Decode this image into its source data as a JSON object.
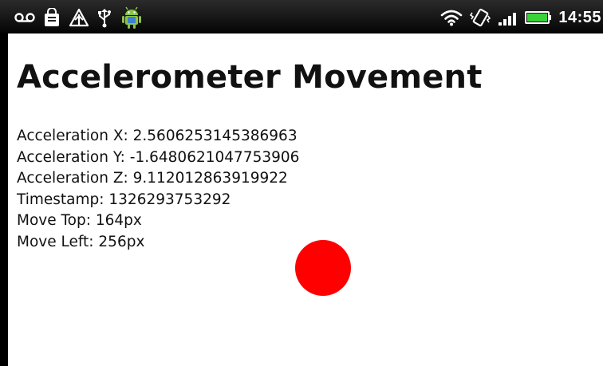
{
  "status_bar": {
    "left_icons": [
      "voicemail-icon",
      "shopping-bag-icon",
      "warning-icon",
      "usb-icon",
      "android-icon"
    ],
    "right_icons": [
      "wifi-icon",
      "vibrate-icon",
      "signal-bars-icon",
      "battery-icon"
    ],
    "time": "14:55"
  },
  "page": {
    "title": "Accelerometer Movement",
    "readings": [
      "Acceleration X: 2.5606253145386963",
      "Acceleration Y: -1.6480621047753906",
      "Acceleration Z: 9.112012863919922",
      "Timestamp: 1326293753292",
      "Move Top: 164px",
      "Move Left: 256px"
    ]
  },
  "colors": {
    "ball": "#ff0000",
    "status_bar": "#111111",
    "battery": "#39d339"
  }
}
